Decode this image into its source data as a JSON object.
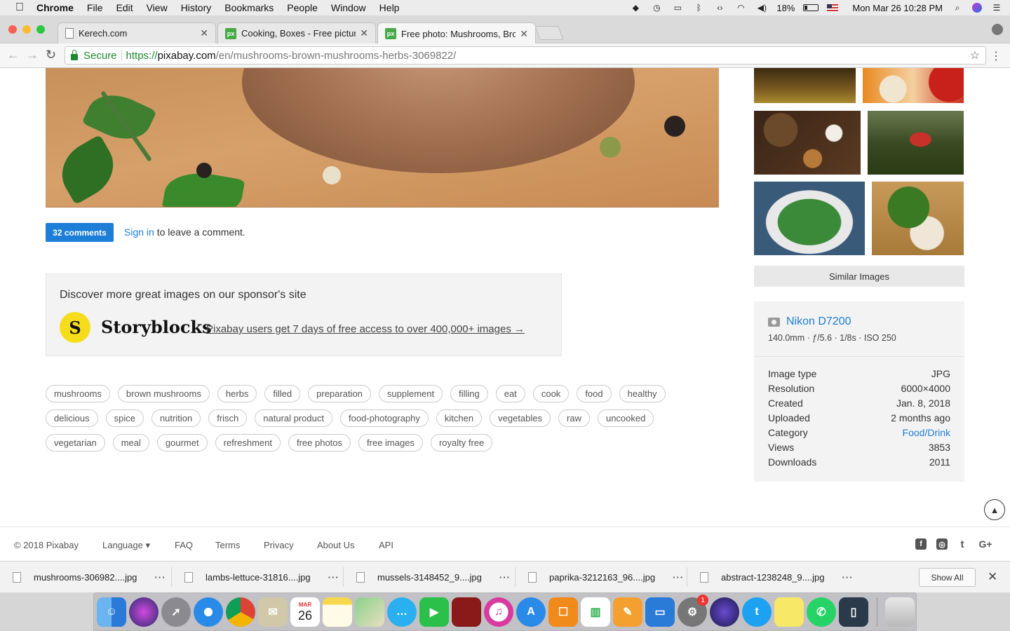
{
  "menubar": {
    "app": "Chrome",
    "items": [
      "File",
      "Edit",
      "View",
      "History",
      "Bookmarks",
      "People",
      "Window",
      "Help"
    ],
    "battery": "18%",
    "datetime": "Mon Mar 26  10:28 PM"
  },
  "tabs": [
    {
      "title": "Kerech.com",
      "favicon": "doc-icon"
    },
    {
      "title": "Cooking, Boxes - Free pictures",
      "favicon": "px"
    },
    {
      "title": "Free photo: Mushrooms, Brown",
      "favicon": "px"
    }
  ],
  "toolbar": {
    "secure_label": "Secure",
    "url_scheme": "https://",
    "url_host": "pixabay.com",
    "url_path": "/en/mushrooms-brown-mushrooms-herbs-3069822/"
  },
  "comments": {
    "button_label": "32 comments",
    "signin_link": "Sign in",
    "signin_rest": " to leave a comment."
  },
  "sponsor": {
    "heading": "Discover more great images on our sponsor's site",
    "logo_glyph": "S",
    "brand": "Storyblocks",
    "link": "Pixabay users get 7 days of free access to over 400,000+ images →"
  },
  "tags": [
    [
      "mushrooms",
      "brown mushrooms",
      "herbs",
      "filled",
      "preparation",
      "supplement",
      "filling",
      "eat",
      "cook",
      "food",
      "healthy"
    ],
    [
      "delicious",
      "spice",
      "nutrition",
      "frisch",
      "natural product",
      "food-photography",
      "kitchen",
      "vegetables",
      "raw",
      "uncooked"
    ],
    [
      "vegetarian",
      "meal",
      "gourmet",
      "refreshment",
      "free photos",
      "free images",
      "royalty free"
    ]
  ],
  "sidebar": {
    "similar_button": "Similar Images",
    "camera": "Nikon D7200",
    "camera_settings": "140.0mm · ƒ/5.6 · 1/8s · ISO 250",
    "details": [
      {
        "label": "Image type",
        "value": "JPG"
      },
      {
        "label": "Resolution",
        "value": "6000×4000"
      },
      {
        "label": "Created",
        "value": "Jan. 8, 2018"
      },
      {
        "label": "Uploaded",
        "value": "2 months ago"
      },
      {
        "label": "Category",
        "value": "Food/Drink"
      },
      {
        "label": "Views",
        "value": "3853"
      },
      {
        "label": "Downloads",
        "value": "2011"
      }
    ]
  },
  "footer": {
    "copyright": "© 2018 Pixabay",
    "language": "Language ▾",
    "links": [
      "FAQ",
      "Terms",
      "Privacy",
      "About Us",
      "API"
    ],
    "social": [
      "f",
      "◎",
      "t",
      "G+"
    ]
  },
  "downloads": {
    "files": [
      "mushrooms-306982....jpg",
      "lambs-lettuce-31816....jpg",
      "mussels-3148452_9....jpg",
      "paprika-3212163_96....jpg",
      "abstract-1238248_9....jpg"
    ],
    "show_all": "Show All"
  },
  "dock": {
    "calendar_month": "MAR",
    "calendar_day": "26",
    "badge": "1"
  },
  "colors": {
    "accent": "#1c7ed6",
    "secure_green": "#1a8a2e",
    "storyblocks_yellow": "#f6dd1c"
  }
}
